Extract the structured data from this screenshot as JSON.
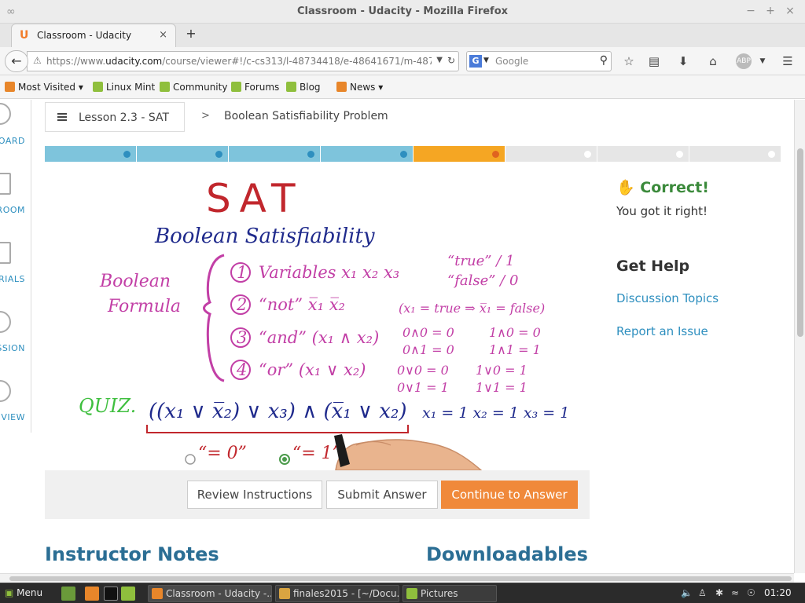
{
  "window": {
    "title": "Classroom - Udacity - Mozilla Firefox",
    "buttons": [
      "−",
      "+",
      "×"
    ]
  },
  "tab": {
    "favicon": "U",
    "label": "Classroom - Udacity",
    "close": "×",
    "new_tab": "+"
  },
  "nav": {
    "url_prefix": "https://www.",
    "url_domain": "udacity.com",
    "url_path": "/course/viewer#!/c-cs313/l-48734418/e-48641671/m-48749046",
    "search_engine": "G",
    "search_placeholder": "Google"
  },
  "bookmarks": [
    {
      "label": "Most Visited ▾",
      "icon": "orange"
    },
    {
      "label": "Linux Mint",
      "icon": "mint"
    },
    {
      "label": "Community",
      "icon": "mint"
    },
    {
      "label": "Forums",
      "icon": "mint"
    },
    {
      "label": "Blog",
      "icon": "mint"
    },
    {
      "label": "News ▾",
      "icon": "orange"
    }
  ],
  "sidenav": [
    {
      "label": "OARD",
      "icon": "circle"
    },
    {
      "label": "ROOM",
      "icon": "square"
    },
    {
      "label": "RIALS",
      "icon": "square"
    },
    {
      "label": "SSION",
      "icon": "circle"
    },
    {
      "label": "VIEW",
      "icon": "circle"
    }
  ],
  "breadcrumb": {
    "lesson": "Lesson 2.3 - SAT",
    "separator": ">",
    "title": "Boolean Satisfiability Problem"
  },
  "progress": {
    "segments": 8,
    "completed": 4,
    "current": 5,
    "colors": {
      "done": "#7ec4dc",
      "done_dot": "#2e8fbf",
      "current": "#f5a623",
      "current_dot": "#e0631f",
      "todo": "#e6e6e6",
      "todo_dot": "#ffffff"
    }
  },
  "whiteboard": {
    "title": "SAT",
    "subtitle": "Boolean Satisfiability",
    "formula_label_1": "Boolean",
    "formula_label_2": "Formula",
    "items": [
      {
        "num": "1",
        "text": "Variables  x₁  x₂  x₃"
      },
      {
        "num": "2",
        "text": "“not”  x̅₁  x̅₂"
      },
      {
        "num": "3",
        "text": "“and” (x₁ ∧ x₂)"
      },
      {
        "num": "4",
        "text": "“or”  (x₁ ∨ x₂)"
      }
    ],
    "true_label": "“true” / 1",
    "false_label": "“false” / 0",
    "not_example": "(x₁ = true ⇒ x̅₁ = false)",
    "and_table_1": "0∧0 = 0",
    "and_table_2": "1∧0 = 0",
    "and_table_3": "0∧1 = 0",
    "and_table_4": "1∧1 = 1",
    "or_table_1": "0∨0 = 0",
    "or_table_2": "1∨0 = 1",
    "or_table_3": "0∨1 = 1",
    "or_table_4": "1∨1 = 1",
    "quiz_label": "QUIZ.",
    "quiz_formula": "((x₁ ∨ x̅₂) ∨ x₃) ∧ (x̅₁ ∨ x₂)",
    "assignment": "x₁ = 1   x₂ = 1   x₃ = 1",
    "option_0": "“= 0”",
    "option_1": "“= 1”"
  },
  "buttons": {
    "review": "Review Instructions",
    "submit": "Submit Answer",
    "continue": "Continue to Answer"
  },
  "feedback": {
    "status": "Correct!",
    "message": "You got it right!"
  },
  "help": {
    "title": "Get Help",
    "links": [
      "Discussion Topics",
      "Report an Issue"
    ]
  },
  "sections": {
    "notes": "Instructor Notes",
    "downloads": "Downloadables"
  },
  "taskbar": {
    "menu": "Menu",
    "tasks": [
      "Classroom - Udacity -...",
      "finales2015 - [~/Docu...",
      "Pictures"
    ],
    "clock": "01:20"
  }
}
